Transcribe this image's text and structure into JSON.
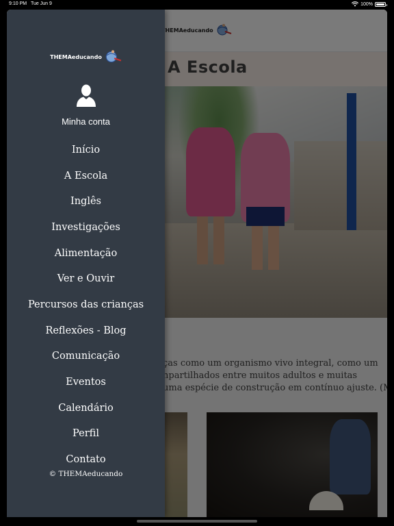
{
  "status_bar": {
    "time": "9:10 PM",
    "date": "Tue Jun 9",
    "battery": "100%",
    "wifi_icon": "wifi-icon",
    "battery_icon": "battery-icon"
  },
  "header": {
    "logo_text": "THEMAeducando"
  },
  "page": {
    "title": "A Escola",
    "intro_lines": [
      "ças como um organismo vivo integral, como um",
      "npartilhados entre muitos adultos e muitas",
      "uma espécie de construção em contínuo ajuste. (M..."
    ]
  },
  "drawer": {
    "logo_text": "THEMAeducando",
    "account_label": "Minha conta",
    "menu": [
      "Início",
      "A Escola",
      "Inglês",
      "Investigações",
      "Alimentação",
      "Ver e Ouvir",
      "Percursos das crianças",
      "Reflexões - Blog",
      "Comunicação",
      "Eventos",
      "Calendário",
      "Perfil",
      "Contato"
    ],
    "copyright": "© THEMAeducando"
  },
  "colors": {
    "drawer_bg": "#333b45",
    "title_bar_bg": "#efe5df"
  }
}
